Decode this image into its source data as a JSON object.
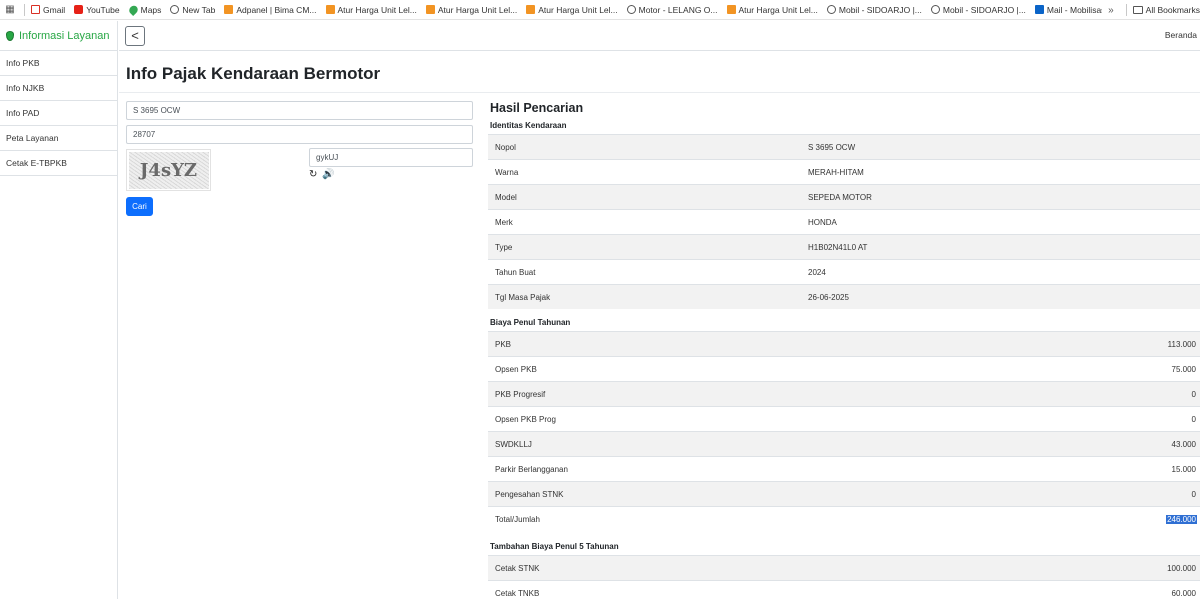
{
  "bookmarks": {
    "items": [
      {
        "label": "Gmail",
        "icon": "gmail-icon"
      },
      {
        "label": "YouTube",
        "icon": "youtube-icon"
      },
      {
        "label": "Maps",
        "icon": "maps-icon"
      },
      {
        "label": "New Tab",
        "icon": "globe-icon"
      },
      {
        "label": "Adpanel | Bima CM...",
        "icon": "orange-site-icon"
      },
      {
        "label": "Atur Harga Unit Lel...",
        "icon": "orange-site-icon"
      },
      {
        "label": "Atur Harga Unit Lel...",
        "icon": "orange-site-icon"
      },
      {
        "label": "Atur Harga Unit Lel...",
        "icon": "orange-site-icon"
      },
      {
        "label": "Motor - LELANG O...",
        "icon": "globe-icon"
      },
      {
        "label": "Atur Harga Unit Lel...",
        "icon": "orange-site-icon"
      },
      {
        "label": "Mobil - SIDOARJO |...",
        "icon": "globe-icon"
      },
      {
        "label": "Mobil - SIDOARJO |...",
        "icon": "globe-icon"
      },
      {
        "label": "Mail - Mobilisasi Ti...",
        "icon": "outlook-icon"
      }
    ],
    "more": "»",
    "all_label": "All Bookmarks"
  },
  "sidebar": {
    "brand": "Informasi Layanan",
    "items": [
      "Info PKB",
      "Info NJKB",
      "Info PAD",
      "Peta Layanan",
      "Cetak E-TBPKB"
    ]
  },
  "topbar": {
    "back": "<",
    "home_link": "Beranda"
  },
  "page": {
    "title": "Info Pajak Kendaraan Bermotor"
  },
  "form": {
    "nopol_value": "S 3695 OCW",
    "code_value": "28707",
    "captcha_text": "J4sYZ",
    "captcha_input_value": "gykUJ",
    "refresh_icon": "↻",
    "audio_icon": "🔊",
    "submit_label": "Cari"
  },
  "results": {
    "title": "Hasil Pencarian",
    "identity_heading": "Identitas Kendaraan",
    "identity": [
      {
        "label": "Nopol",
        "value": "S 3695 OCW"
      },
      {
        "label": "Warna",
        "value": "MERAH-HITAM"
      },
      {
        "label": "Model",
        "value": "SEPEDA MOTOR"
      },
      {
        "label": "Merk",
        "value": "HONDA"
      },
      {
        "label": "Type",
        "value": "H1B02N41L0 AT"
      },
      {
        "label": "Tahun Buat",
        "value": "2024"
      },
      {
        "label": "Tgl Masa Pajak",
        "value": "26-06-2025"
      }
    ],
    "annual_heading": "Biaya Penul Tahunan",
    "annual": [
      {
        "label": "PKB",
        "value": "113.000"
      },
      {
        "label": "Opsen PKB",
        "value": "75.000"
      },
      {
        "label": "PKB Progresif",
        "value": "0"
      },
      {
        "label": "Opsen PKB Prog",
        "value": "0"
      },
      {
        "label": "SWDKLLJ",
        "value": "43.000"
      },
      {
        "label": "Parkir Berlangganan",
        "value": "15.000"
      },
      {
        "label": "Pengesahan STNK",
        "value": "0"
      },
      {
        "label": "Total/Jumlah",
        "value": "246.000"
      }
    ],
    "five_year_heading": "Tambahan Biaya Penul 5 Tahunan",
    "five_year": [
      {
        "label": "Cetak STNK",
        "value": "100.000"
      },
      {
        "label": "Cetak TNKB",
        "value": "60.000"
      }
    ]
  }
}
